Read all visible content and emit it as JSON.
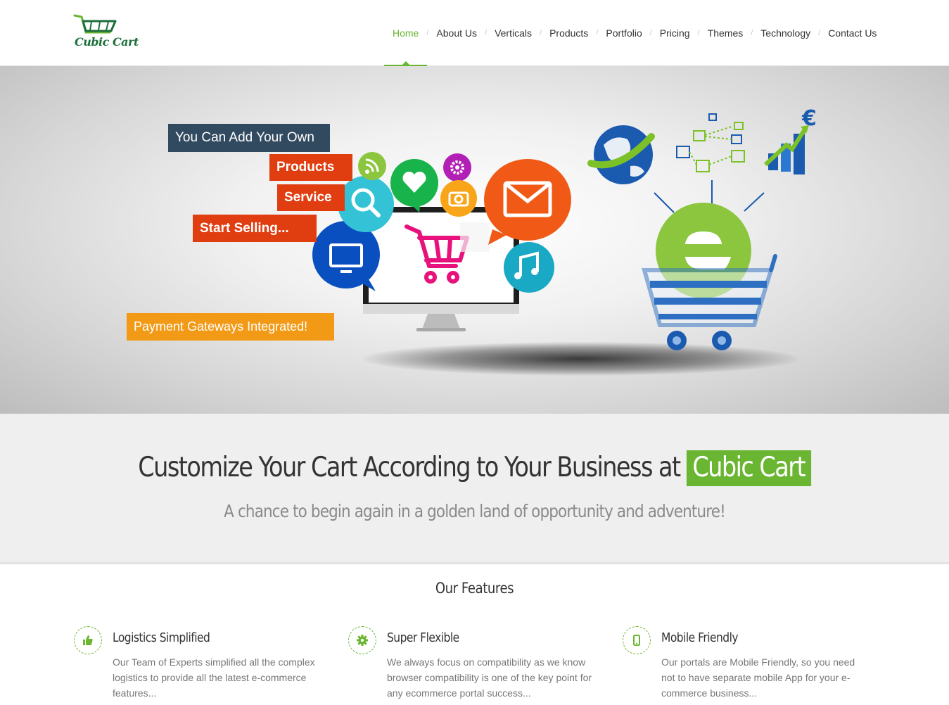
{
  "header": {
    "logo_text": "Cubic Cart",
    "nav": [
      {
        "label": "Home"
      },
      {
        "label": "About Us"
      },
      {
        "label": "Verticals"
      },
      {
        "label": "Products"
      },
      {
        "label": "Portfolio"
      },
      {
        "label": "Pricing"
      },
      {
        "label": "Themes"
      },
      {
        "label": "Technology"
      },
      {
        "label": "Contact Us"
      }
    ]
  },
  "hero": {
    "tag_own": "You Can Add Your Own",
    "tag_products": "Products",
    "tag_service": "Service",
    "tag_selling": "Start Selling...",
    "tag_payment": "Payment Gateways Integrated!"
  },
  "tagline": {
    "title": "Customize Your Cart According to Your Business at",
    "highlight": "Cubic Cart",
    "subtitle": "A chance to begin again in a golden land of opportunity and adventure!"
  },
  "features": {
    "heading": "Our Features",
    "items": [
      {
        "icon": "thumbs-up-icon",
        "title": "Logistics Simplified",
        "desc": "Our Team of Experts simplified all the complex logistics to provide all the latest e-commerce features..."
      },
      {
        "icon": "gear-icon",
        "title": "Super Flexible",
        "desc": "We always focus on compatibility as we know browser compatibility is one of the key point for any ecommerce portal success..."
      },
      {
        "icon": "mobile-icon",
        "title": "Mobile Friendly",
        "desc": "Our portals are Mobile Friendly, so you need not to have separate mobile App for your e-commerce business..."
      }
    ]
  },
  "colors": {
    "accent_green": "#6ab531",
    "tag_red": "#e03d10",
    "tag_dark": "#324a5f",
    "tag_orange": "#f29a16"
  }
}
